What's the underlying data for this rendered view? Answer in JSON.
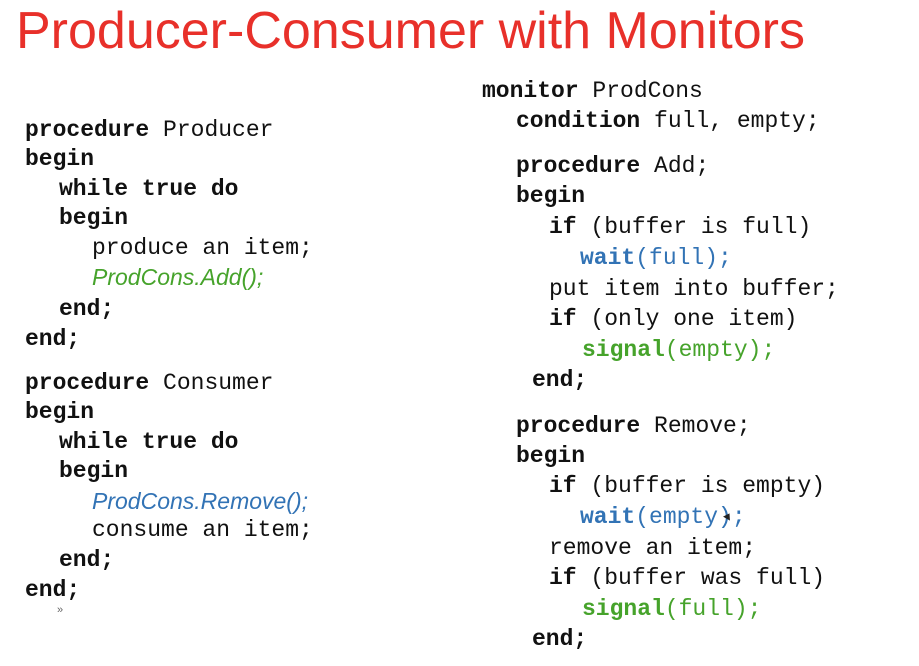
{
  "title": "Producer-Consumer with Monitors",
  "left": {
    "producer_kw": "procedure",
    "producer_name": " Producer",
    "begin1": "begin",
    "while1": "while true do",
    "begin2": "begin",
    "produce": "produce an item;",
    "add_call": "ProdCons.Add();",
    "end1": "end;",
    "end2": "end;",
    "consumer_kw": "procedure",
    "consumer_name": " Consumer",
    "begin3": "begin",
    "while2": "while true do",
    "begin4": "begin",
    "remove_call": "ProdCons.Remove();",
    "consume": "consume an item;",
    "end3": "end;",
    "end4": "end;",
    "mark": "»"
  },
  "right": {
    "monitor_kw": "monitor",
    "monitor_name": " ProdCons",
    "condition_kw": "condition",
    "condition_vars": " full, empty;",
    "add_kw": "procedure",
    "add_name": " Add;",
    "add_begin": "begin",
    "add_if1_kw": "if",
    "add_if1_cond": " (buffer is full)",
    "add_wait_kw": "wait",
    "add_wait_arg": "(full);",
    "add_put": "put item into buffer;",
    "add_if2_kw": "if",
    "add_if2_cond": " (only one item)",
    "add_signal_kw": "signal",
    "add_signal_arg": "(empty);",
    "add_end": "end;",
    "rem_kw": "procedure",
    "rem_name": " Remove;",
    "rem_begin": "begin",
    "rem_if1_kw": "if",
    "rem_if1_cond": " (buffer is empty)",
    "rem_wait_kw": "wait",
    "rem_wait_arg": "(empty);",
    "rem_remove": "remove an item;",
    "rem_if2_kw": "if",
    "rem_if2_cond": " (buffer was full)",
    "rem_signal_kw": "signal",
    "rem_signal_arg": "(full);",
    "rem_end": "end;"
  },
  "colors": {
    "title": "#e8302a",
    "green": "#46a32b",
    "blue": "#3273b5",
    "text": "#111111"
  }
}
